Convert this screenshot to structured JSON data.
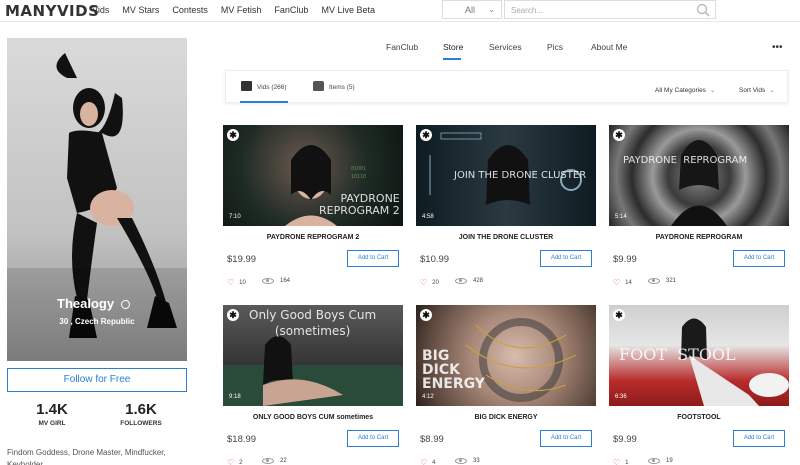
{
  "nav": {
    "logo": "MANYVIDS",
    "links": [
      "Vids",
      "MV Stars",
      "Contests",
      "MV Fetish",
      "FanClub",
      "MV Live Beta"
    ],
    "category_selected": "All",
    "search_placeholder": "Search..."
  },
  "profile": {
    "name": "Thealogy",
    "location": "30 , Czech Republic",
    "follow_label": "Follow for Free",
    "stats": [
      {
        "value": "1.4K",
        "label": "MV GIRL"
      },
      {
        "value": "1.6K",
        "label": "FOLLOWERS"
      }
    ],
    "bio": "Findom Goddess, Drone Master, Mindfucker, Keyholder"
  },
  "tabs": [
    "FanClub",
    "Store",
    "Services",
    "Pics",
    "About Me"
  ],
  "active_tab": "Store",
  "more_label": "•••",
  "filter": {
    "vids_label": "Vids (266)",
    "items_label": "Items (5)",
    "categories_label": "All My Categories",
    "sort_label": "Sort Vids"
  },
  "add_to_cart_label": "Add to Cart",
  "videos": [
    {
      "title": "PAYDRONE REPROGRAM 2",
      "duration": "7:10",
      "price": "$19.99",
      "likes": "10",
      "views": "164",
      "overlay": "PAYDRONE\nREPROGRAM 2"
    },
    {
      "title": "JOIN THE DRONE CLUSTER",
      "duration": "4:58",
      "price": "$10.99",
      "likes": "20",
      "views": "428",
      "overlay": "JOIN THE DRONE CLUSTER"
    },
    {
      "title": "PAYDRONE REPROGRAM",
      "duration": "5:14",
      "price": "$9.99",
      "likes": "14",
      "views": "321",
      "overlay": "PAYDRONE  REPROGRAM"
    },
    {
      "title": "ONLY GOOD BOYS CUM sometimes",
      "duration": "9:18",
      "price": "$18.99",
      "likes": "2",
      "views": "22",
      "overlay": "Only Good Boys Cum\n(sometimes)"
    },
    {
      "title": "BIG DICK ENERGY",
      "duration": "4:12",
      "price": "$8.99",
      "likes": "4",
      "views": "33",
      "overlay": "BIG\nDICK\nENERGY"
    },
    {
      "title": "FOOTSTOOL",
      "duration": "6:36",
      "price": "$9.99",
      "likes": "1",
      "views": "19",
      "overlay": "FOOT  STOOL"
    }
  ]
}
